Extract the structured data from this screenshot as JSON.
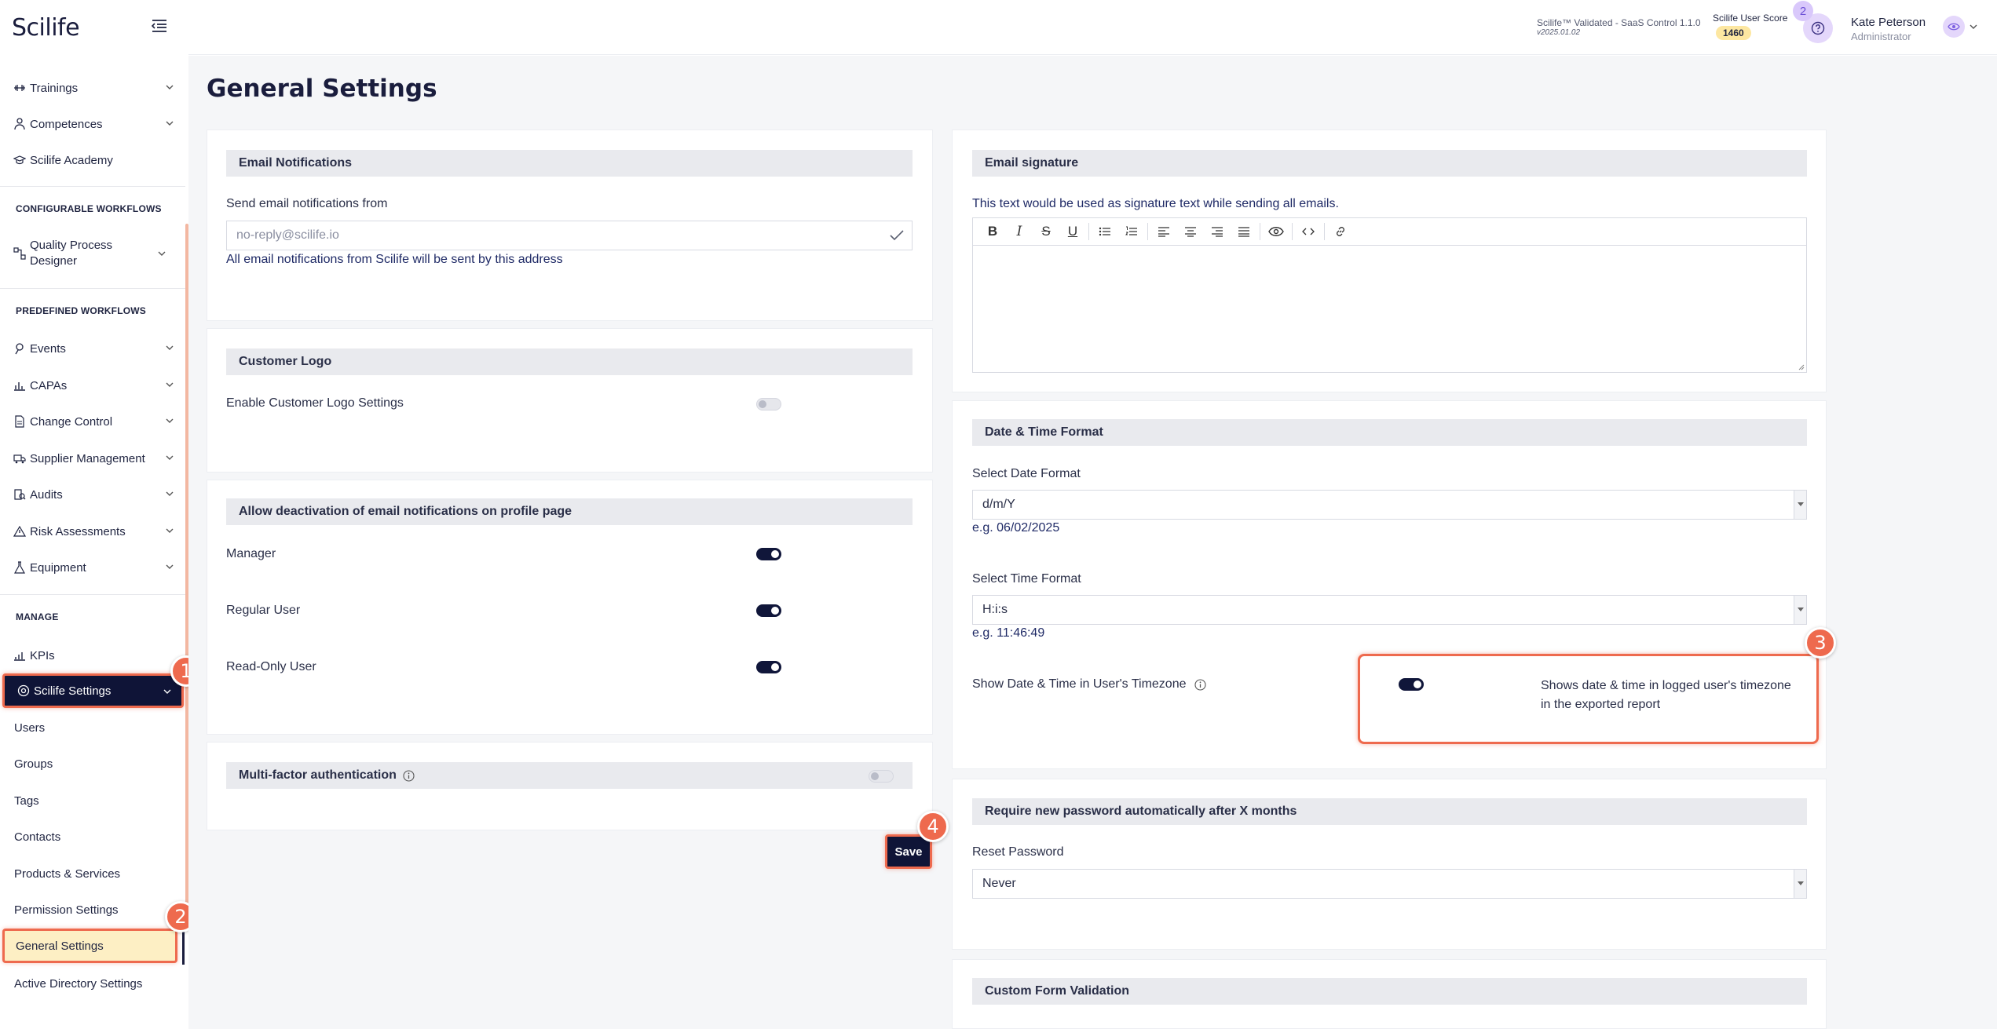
{
  "app": {
    "logo": "Scilife",
    "version": "Scilife™ Validated - SaaS Control 1.1.0",
    "version_sub": "v2025.01.02",
    "user_score_label": "Scilife User Score",
    "user_score_value": "1460",
    "notification_count": "2",
    "user_name": "Kate Peterson",
    "user_role": "Administrator"
  },
  "sidebar": {
    "items_top": [
      {
        "label": "Trainings",
        "icon": "dumbbell-icon"
      },
      {
        "label": "Competences",
        "icon": "person-icon"
      },
      {
        "label": "Scilife Academy",
        "icon": "graduation-cap-icon"
      }
    ],
    "section_configurable": "CONFIGURABLE WORKFLOWS",
    "quality_process": "Quality Process Designer",
    "section_predefined": "PREDEFINED WORKFLOWS",
    "items_predefined": [
      {
        "label": "Events",
        "icon": "pin-icon"
      },
      {
        "label": "CAPAs",
        "icon": "chart-icon"
      },
      {
        "label": "Change Control",
        "icon": "document-icon"
      },
      {
        "label": "Supplier Management",
        "icon": "truck-icon"
      },
      {
        "label": "Audits",
        "icon": "audit-icon"
      },
      {
        "label": "Risk Assessments",
        "icon": "warning-icon"
      },
      {
        "label": "Equipment",
        "icon": "flask-icon"
      }
    ],
    "section_manage": "MANAGE",
    "kpis": "KPIs",
    "settings": "Scilife Settings",
    "sub_items": [
      "Users",
      "Groups",
      "Tags",
      "Contacts",
      "Products & Services",
      "Permission Settings"
    ],
    "active_sub": "General Settings",
    "last_sub": "Active Directory Settings"
  },
  "badges": {
    "b1": "1",
    "b2": "2",
    "b3": "3",
    "b4": "4"
  },
  "page": {
    "title": "General Settings",
    "email_notifications": {
      "header": "Email Notifications",
      "label": "Send email notifications from",
      "placeholder": "no-reply@scilife.io",
      "help": "All email notifications from Scilife will be sent by this address"
    },
    "customer_logo": {
      "header": "Customer Logo",
      "label": "Enable Customer Logo Settings"
    },
    "deactivation": {
      "header": "Allow deactivation of email notifications on profile page",
      "manager": "Manager",
      "regular": "Regular User",
      "readonly": "Read-Only User"
    },
    "mfa": {
      "header": "Multi-factor authentication"
    },
    "save": "Save",
    "email_signature": {
      "header": "Email signature",
      "help": "This text would be used as signature text while sending all emails."
    },
    "datetime": {
      "header": "Date & Time Format",
      "date_label": "Select Date Format",
      "date_value": "d/m/Y",
      "date_example": "e.g. 06/02/2025",
      "time_label": "Select Time Format",
      "time_value": "H:i:s",
      "time_example": "e.g. 11:46:49",
      "tz_label": "Show Date & Time in User's Timezone",
      "tz_desc_1": "Shows date & time in logged user's timezone",
      "tz_desc_2": "in the exported report"
    },
    "password": {
      "header": "Require new password automatically after X months",
      "label": "Reset Password",
      "value": "Never"
    },
    "custom_form": {
      "header": "Custom Form Validation"
    }
  },
  "colors": {
    "accent": "#ee6a4e",
    "navy": "#0f1437",
    "highlight": "#fdefc4"
  }
}
